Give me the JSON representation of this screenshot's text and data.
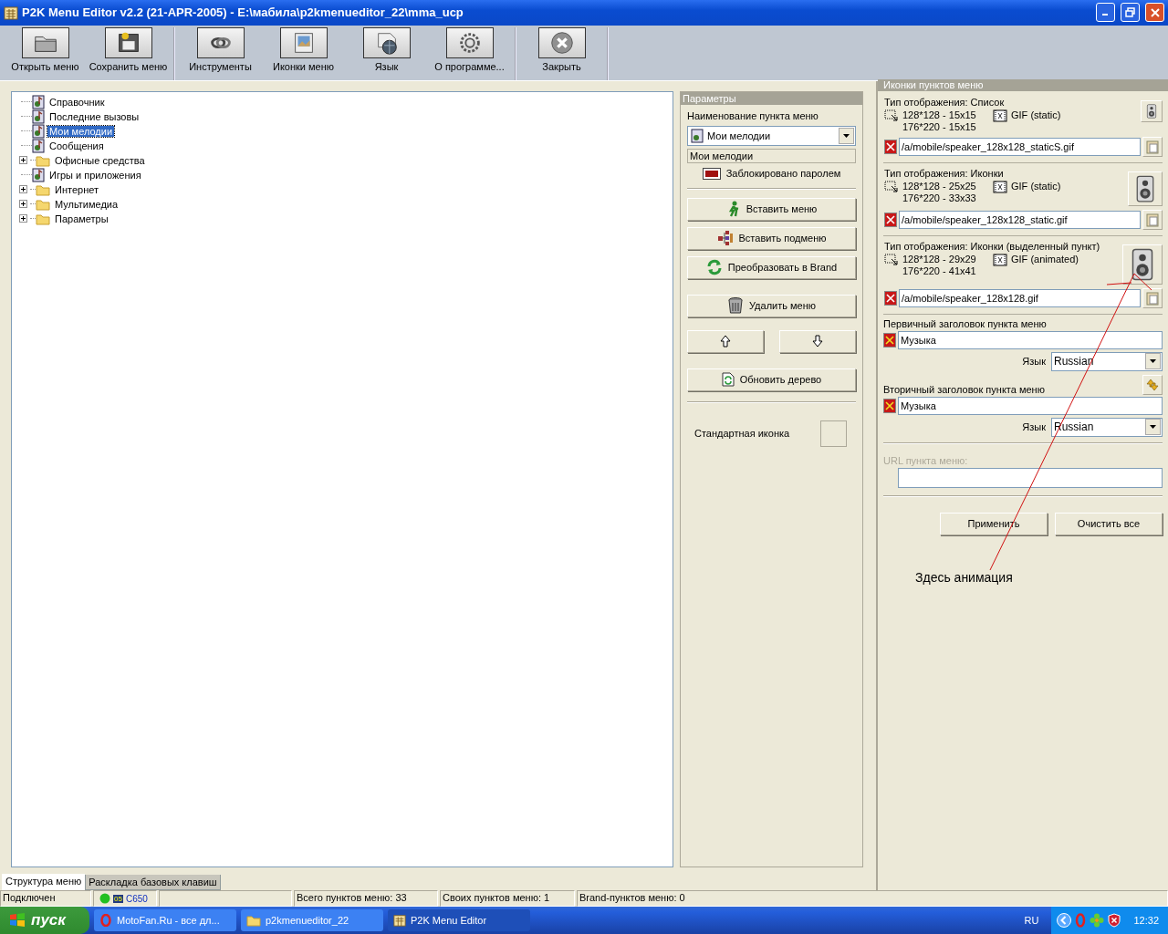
{
  "window": {
    "title": "P2K Menu Editor v2.2 (21-APR-2005) - E:\\мабила\\p2kmenueditor_22\\mma_ucp"
  },
  "toolbar": [
    [
      {
        "label": "Открыть меню",
        "kind": "folder"
      },
      {
        "label": "Сохранить меню",
        "kind": "save"
      }
    ],
    [
      {
        "label": "Инструменты",
        "kind": "tools"
      },
      {
        "label": "Иконки меню",
        "kind": "picture"
      },
      {
        "label": "Язык",
        "kind": "globe"
      },
      {
        "label": "О программе...",
        "kind": "gear"
      }
    ],
    [
      {
        "label": "Закрыть",
        "kind": "close"
      }
    ]
  ],
  "tree": [
    {
      "label": "Справочник",
      "kind": "item",
      "selected": false
    },
    {
      "label": "Последние вызовы",
      "kind": "item",
      "selected": false
    },
    {
      "label": "Мои мелодии",
      "kind": "item",
      "selected": true
    },
    {
      "label": "Сообщения",
      "kind": "item",
      "selected": false
    },
    {
      "label": "Офисные средства",
      "kind": "folder",
      "selected": false,
      "expanded": false
    },
    {
      "label": "Игры и приложения",
      "kind": "item",
      "selected": false
    },
    {
      "label": "Интернет",
      "kind": "folder",
      "selected": false,
      "expanded": false
    },
    {
      "label": "Мультимедиа",
      "kind": "folder",
      "selected": false,
      "expanded": false
    },
    {
      "label": "Параметры",
      "kind": "folder",
      "selected": false,
      "expanded": false
    }
  ],
  "params": {
    "title": "Параметры",
    "name_label": "Наименование пункта меню",
    "name_value": "Мои мелодии",
    "name_display": "Мои мелодии",
    "lock_label": "Заблокировано паролем",
    "buttons": [
      {
        "label": "Вставить меню",
        "kind": "insert"
      },
      {
        "label": "Вставить подменю",
        "kind": "submenu"
      },
      {
        "label": "Преобразовать в Brand",
        "kind": "convert"
      },
      {
        "label": "Удалить меню",
        "kind": "delete"
      }
    ],
    "refresh": "Обновить дерево",
    "standard_icon_label": "Стандартная иконка"
  },
  "icons": {
    "title": "Иконки пунктов меню",
    "sets": [
      {
        "type_label": "Тип отображения: Список",
        "size_a": "128*128 - 15x15",
        "size_b": "176*220 - 15x15",
        "format": "GIF (static)",
        "path": "/a/mobile/speaker_128x128_staticS.gif"
      },
      {
        "type_label": "Тип отображения: Иконки",
        "size_a": "128*128 - 25x25",
        "size_b": "176*220 - 33x33",
        "format": "GIF (static)",
        "path": "/a/mobile/speaker_128x128_static.gif"
      },
      {
        "type_label": "Тип отображения: Иконки (выделенный пункт)",
        "size_a": "128*128 - 29x29",
        "size_b": "176*220 - 41x41",
        "format": "GIF (animated)",
        "path": "/a/mobile/speaker_128x128.gif"
      }
    ],
    "titles": [
      {
        "label": "Первичный заголовок пункта меню",
        "value": "Музыка",
        "language_label": "Язык",
        "language": "Russian"
      },
      {
        "label": "Вторичный заголовок пункта меню",
        "value": "Музыка",
        "language_label": "Язык",
        "language": "Russian"
      }
    ],
    "url": {
      "label": "URL пункта меню:",
      "disabled": true
    },
    "buttons": [
      "Применить",
      "Очистить все"
    ]
  },
  "annotation": {
    "text": "Здесь анимация"
  },
  "tabs": [
    {
      "label": "Структура меню",
      "selected": true
    },
    {
      "label": "Раскладка базовых клавиш",
      "selected": false
    }
  ],
  "status_bar": {
    "connection": "Подключен",
    "phone": "C650",
    "phone_badge": "05",
    "total": "Всего пунктов меню: 33",
    "own": "Своих пунктов меню: 1",
    "brand": "Brand-пунктов меню: 0"
  },
  "taskbar": {
    "start": "пуск",
    "tasks": [
      {
        "label": "MotoFan.Ru - все дл...",
        "kind": "browser",
        "selected": false
      },
      {
        "label": "p2kmenueditor_22",
        "kind": "folder",
        "selected": false
      },
      {
        "label": "P2K Menu Editor",
        "kind": "app",
        "selected": true
      }
    ],
    "language": "RU",
    "time": "12:32"
  }
}
